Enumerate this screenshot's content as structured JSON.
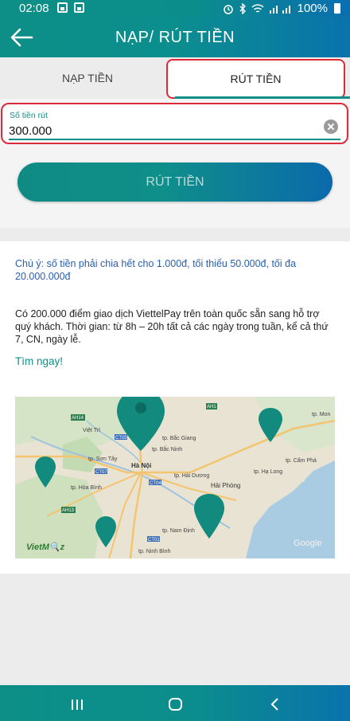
{
  "status_bar": {
    "time": "02:08",
    "battery": "100%"
  },
  "app_bar": {
    "title": "NẠP/ RÚT TIỀN"
  },
  "tabs": [
    {
      "label": "NẠP TIỀN",
      "selected": false
    },
    {
      "label": "RÚT TIỀN",
      "selected": true
    }
  ],
  "withdraw_form": {
    "amount_label": "Số tiền rút",
    "amount_value": "300.000",
    "submit_label": "RÚT TIỀN"
  },
  "info": {
    "note": "Chú ý: số tiền phải chia hết cho 1.000đ, tối thiểu 50.000đ, tối đa 20.000.000đ",
    "description": "Có 200.000 điểm giao dịch ViettelPay trên toàn quốc sẵn sang hỗ trợ quý khách. Thời gian: từ 8h – 20h tất cả các ngày trong tuần, kể cả thứ 7, CN, ngày lễ.",
    "find_link": "Tìm ngay!"
  },
  "map": {
    "places": [
      "Việt Trì",
      "tp. Bắc Giang",
      "tp. Sơn Tây",
      "tp. Bắc Ninh",
      "Hà Nội",
      "tp. Hải Dương",
      "tp. Hạ Long",
      "tp. Cẩm Phả",
      "tp. Hòa Bình",
      "Hải Phòng",
      "tp. Nam Định",
      "tp. Ninh Bình",
      "tp. Mon"
    ],
    "roads": [
      "AH14",
      "AH1",
      "AH13",
      "CT05",
      "CT04",
      "CT01",
      "CT07"
    ],
    "brand_left": "VietM🔍z",
    "brand_right": "Google",
    "pin_color": "#128a7e"
  },
  "colors": {
    "accent": "#0e8f88",
    "highlight": "#d92b3a",
    "note_blue": "#2a5fb0"
  }
}
